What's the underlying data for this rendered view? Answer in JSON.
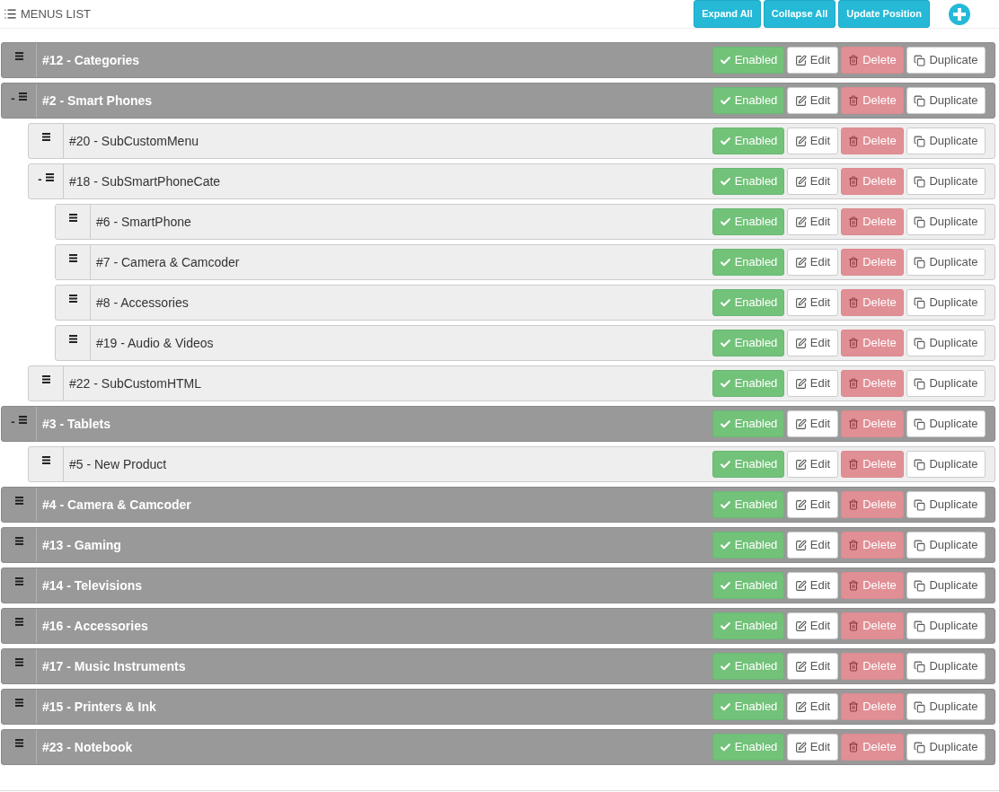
{
  "header": {
    "title": "MENUS LIST",
    "buttons": [
      "Expand All",
      "Collapse All",
      "Update Position"
    ]
  },
  "menus": [
    {
      "label": "#12 - Categories",
      "actions": [
        {
          "kind": "status",
          "label": "Enabled"
        },
        {
          "kind": "edit",
          "label": "Edit"
        },
        {
          "kind": "delete",
          "label": "Delete"
        },
        {
          "kind": "duplicate",
          "label": "Duplicate"
        }
      ]
    },
    {
      "label": "#2 - Smart Phones",
      "toggle": "-",
      "actions": [
        {
          "kind": "status",
          "label": "Enabled"
        },
        {
          "kind": "edit",
          "label": "Edit"
        },
        {
          "kind": "delete",
          "label": "Delete"
        },
        {
          "kind": "duplicate",
          "label": "Duplicate"
        }
      ],
      "children": [
        {
          "label": "#20 - SubCustomMenu",
          "actions": [
            {
              "kind": "status",
              "label": "Enabled"
            },
            {
              "kind": "edit",
              "label": "Edit"
            },
            {
              "kind": "delete",
              "label": "Delete"
            },
            {
              "kind": "duplicate",
              "label": "Duplicate"
            }
          ]
        },
        {
          "label": "#18 - SubSmartPhoneCate",
          "toggle": "-",
          "actions": [
            {
              "kind": "status",
              "label": "Enabled"
            },
            {
              "kind": "edit",
              "label": "Edit"
            },
            {
              "kind": "delete",
              "label": "Delete"
            },
            {
              "kind": "duplicate",
              "label": "Duplicate"
            }
          ],
          "children": [
            {
              "label": "#6 - SmartPhone",
              "actions": [
                {
                  "kind": "status",
                  "label": "Enabled"
                },
                {
                  "kind": "edit",
                  "label": "Edit"
                },
                {
                  "kind": "delete",
                  "label": "Delete"
                },
                {
                  "kind": "duplicate",
                  "label": "Duplicate"
                }
              ]
            },
            {
              "label": "#7 - Camera & Camcoder",
              "actions": [
                {
                  "kind": "status",
                  "label": "Enabled"
                },
                {
                  "kind": "edit",
                  "label": "Edit"
                },
                {
                  "kind": "delete",
                  "label": "Delete"
                },
                {
                  "kind": "duplicate",
                  "label": "Duplicate"
                }
              ]
            },
            {
              "label": "#8 - Accessories",
              "actions": [
                {
                  "kind": "status",
                  "label": "Enabled"
                },
                {
                  "kind": "edit",
                  "label": "Edit"
                },
                {
                  "kind": "delete",
                  "label": "Delete"
                },
                {
                  "kind": "duplicate",
                  "label": "Duplicate"
                }
              ]
            },
            {
              "label": "#19 - Audio & Videos",
              "actions": [
                {
                  "kind": "status",
                  "label": "Enabled"
                },
                {
                  "kind": "edit",
                  "label": "Edit"
                },
                {
                  "kind": "delete",
                  "label": "Delete"
                },
                {
                  "kind": "duplicate",
                  "label": "Duplicate"
                }
              ]
            }
          ]
        },
        {
          "label": "#22 - SubCustomHTML",
          "actions": [
            {
              "kind": "status",
              "label": "Enabled"
            },
            {
              "kind": "edit",
              "label": "Edit"
            },
            {
              "kind": "delete",
              "label": "Delete"
            },
            {
              "kind": "duplicate",
              "label": "Duplicate"
            }
          ]
        }
      ]
    },
    {
      "label": "#3 - Tablets",
      "toggle": "-",
      "actions": [
        {
          "kind": "status",
          "label": "Enabled"
        },
        {
          "kind": "edit",
          "label": "Edit"
        },
        {
          "kind": "delete",
          "label": "Delete"
        },
        {
          "kind": "duplicate",
          "label": "Duplicate"
        }
      ],
      "children": [
        {
          "label": "#5 - New Product",
          "actions": [
            {
              "kind": "status",
              "label": "Enabled"
            },
            {
              "kind": "edit",
              "label": "Edit"
            },
            {
              "kind": "delete",
              "label": "Delete"
            },
            {
              "kind": "duplicate",
              "label": "Duplicate"
            }
          ]
        }
      ]
    },
    {
      "label": "#4 - Camera & Camcoder",
      "actions": [
        {
          "kind": "status",
          "label": "Enabled"
        },
        {
          "kind": "edit",
          "label": "Edit"
        },
        {
          "kind": "delete",
          "label": "Delete"
        },
        {
          "kind": "duplicate",
          "label": "Duplicate"
        }
      ]
    },
    {
      "label": "#13 - Gaming",
      "actions": [
        {
          "kind": "status",
          "label": "Enabled"
        },
        {
          "kind": "edit",
          "label": "Edit"
        },
        {
          "kind": "delete",
          "label": "Delete"
        },
        {
          "kind": "duplicate",
          "label": "Duplicate"
        }
      ]
    },
    {
      "label": "#14 - Televisions",
      "actions": [
        {
          "kind": "status",
          "label": "Enabled"
        },
        {
          "kind": "edit",
          "label": "Edit"
        },
        {
          "kind": "delete",
          "label": "Delete"
        },
        {
          "kind": "duplicate",
          "label": "Duplicate"
        }
      ]
    },
    {
      "label": "#16 - Accessories",
      "actions": [
        {
          "kind": "status",
          "label": "Enabled"
        },
        {
          "kind": "edit",
          "label": "Edit"
        },
        {
          "kind": "delete",
          "label": "Delete"
        },
        {
          "kind": "duplicate",
          "label": "Duplicate"
        }
      ]
    },
    {
      "label": "#17 - Music Instruments",
      "actions": [
        {
          "kind": "status",
          "label": "Enabled"
        },
        {
          "kind": "edit",
          "label": "Edit"
        },
        {
          "kind": "delete",
          "label": "Delete"
        },
        {
          "kind": "duplicate",
          "label": "Duplicate"
        }
      ]
    },
    {
      "label": "#15 - Printers & Ink",
      "actions": [
        {
          "kind": "status",
          "label": "Enabled"
        },
        {
          "kind": "edit",
          "label": "Edit"
        },
        {
          "kind": "delete",
          "label": "Delete"
        },
        {
          "kind": "duplicate",
          "label": "Duplicate"
        }
      ]
    },
    {
      "label": "#23 - Notebook",
      "actions": [
        {
          "kind": "status",
          "label": "Enabled"
        },
        {
          "kind": "edit",
          "label": "Edit"
        },
        {
          "kind": "delete",
          "label": "Delete"
        },
        {
          "kind": "duplicate",
          "label": "Duplicate"
        }
      ]
    }
  ]
}
